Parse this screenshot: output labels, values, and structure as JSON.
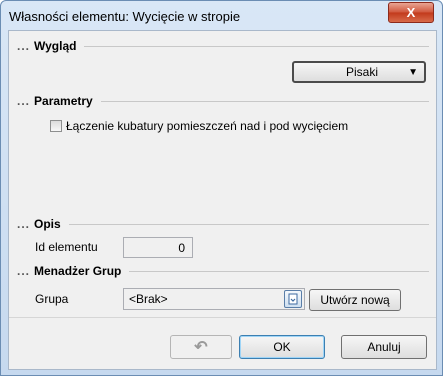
{
  "window": {
    "title": "Własności elementu: Wycięcie w stropie",
    "close_label": "X"
  },
  "sections": {
    "appearance": {
      "dots": "...",
      "label": "Wygląd"
    },
    "parameters": {
      "dots": "...",
      "label": "Parametry"
    },
    "description": {
      "dots": "...",
      "label": "Opis"
    },
    "group_manager": {
      "dots": "...",
      "label": "Menadżer Grup"
    }
  },
  "appearance": {
    "pens_button_label": "Pisaki",
    "pens_arrow": "▼"
  },
  "parameters": {
    "join_volumes_checked": false,
    "join_volumes_label": "Łączenie kubatury pomieszczeń nad i pod wycięciem"
  },
  "description": {
    "element_id_label": "Id elementu",
    "element_id_value": "0"
  },
  "group": {
    "label": "Grupa",
    "selected": "<Brak>",
    "create_new_label": "Utwórz nową"
  },
  "buttons": {
    "undo_icon": "↶",
    "ok_label": "OK",
    "cancel_label": "Anuluj"
  }
}
